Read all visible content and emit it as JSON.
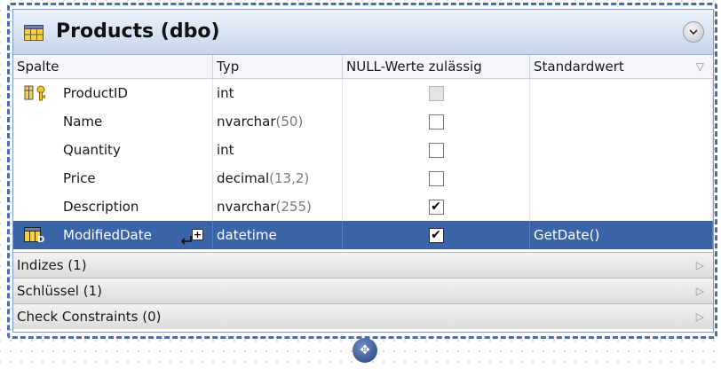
{
  "table": {
    "title": "Products (dbo)",
    "icons": {
      "table": "table-icon",
      "collapse": "collapse-chevron-icon"
    }
  },
  "columns_header": {
    "name": "Spalte",
    "type": "Typ",
    "nullable": "NULL-Werte zulässig",
    "default": "Standardwert",
    "sort_icon": "▽"
  },
  "rows": [
    {
      "name": "ProductID",
      "type_name": "int",
      "type_args": "",
      "nullable": false,
      "nullable_disabled": true,
      "default": "",
      "icon": "primary-key-icon"
    },
    {
      "name": "Name",
      "type_name": "nvarchar",
      "type_args": "(50)",
      "nullable": false,
      "nullable_disabled": false,
      "default": "",
      "icon": ""
    },
    {
      "name": "Quantity",
      "type_name": "int",
      "type_args": "",
      "nullable": false,
      "nullable_disabled": false,
      "default": "",
      "icon": ""
    },
    {
      "name": "Price",
      "type_name": "decimal",
      "type_args": "(13,2)",
      "nullable": false,
      "nullable_disabled": false,
      "default": "",
      "icon": ""
    },
    {
      "name": "Description",
      "type_name": "nvarchar",
      "type_args": "(255)",
      "nullable": true,
      "nullable_disabled": false,
      "default": "",
      "icon": ""
    },
    {
      "name": "ModifiedDate",
      "type_name": "datetime",
      "type_args": "",
      "nullable": true,
      "nullable_disabled": false,
      "default": "GetDate()",
      "icon": "column-edit-icon",
      "selected": true
    }
  ],
  "sections": [
    {
      "label": "Indizes (1)"
    },
    {
      "label": "Schlüssel (1)"
    },
    {
      "label": "Check Constraints (0)"
    }
  ],
  "colors": {
    "selection": "#3a63a8",
    "frame": "#4a6fb0"
  },
  "check_mark": "✔",
  "expand_glyph": "+",
  "section_arrow": "▷"
}
